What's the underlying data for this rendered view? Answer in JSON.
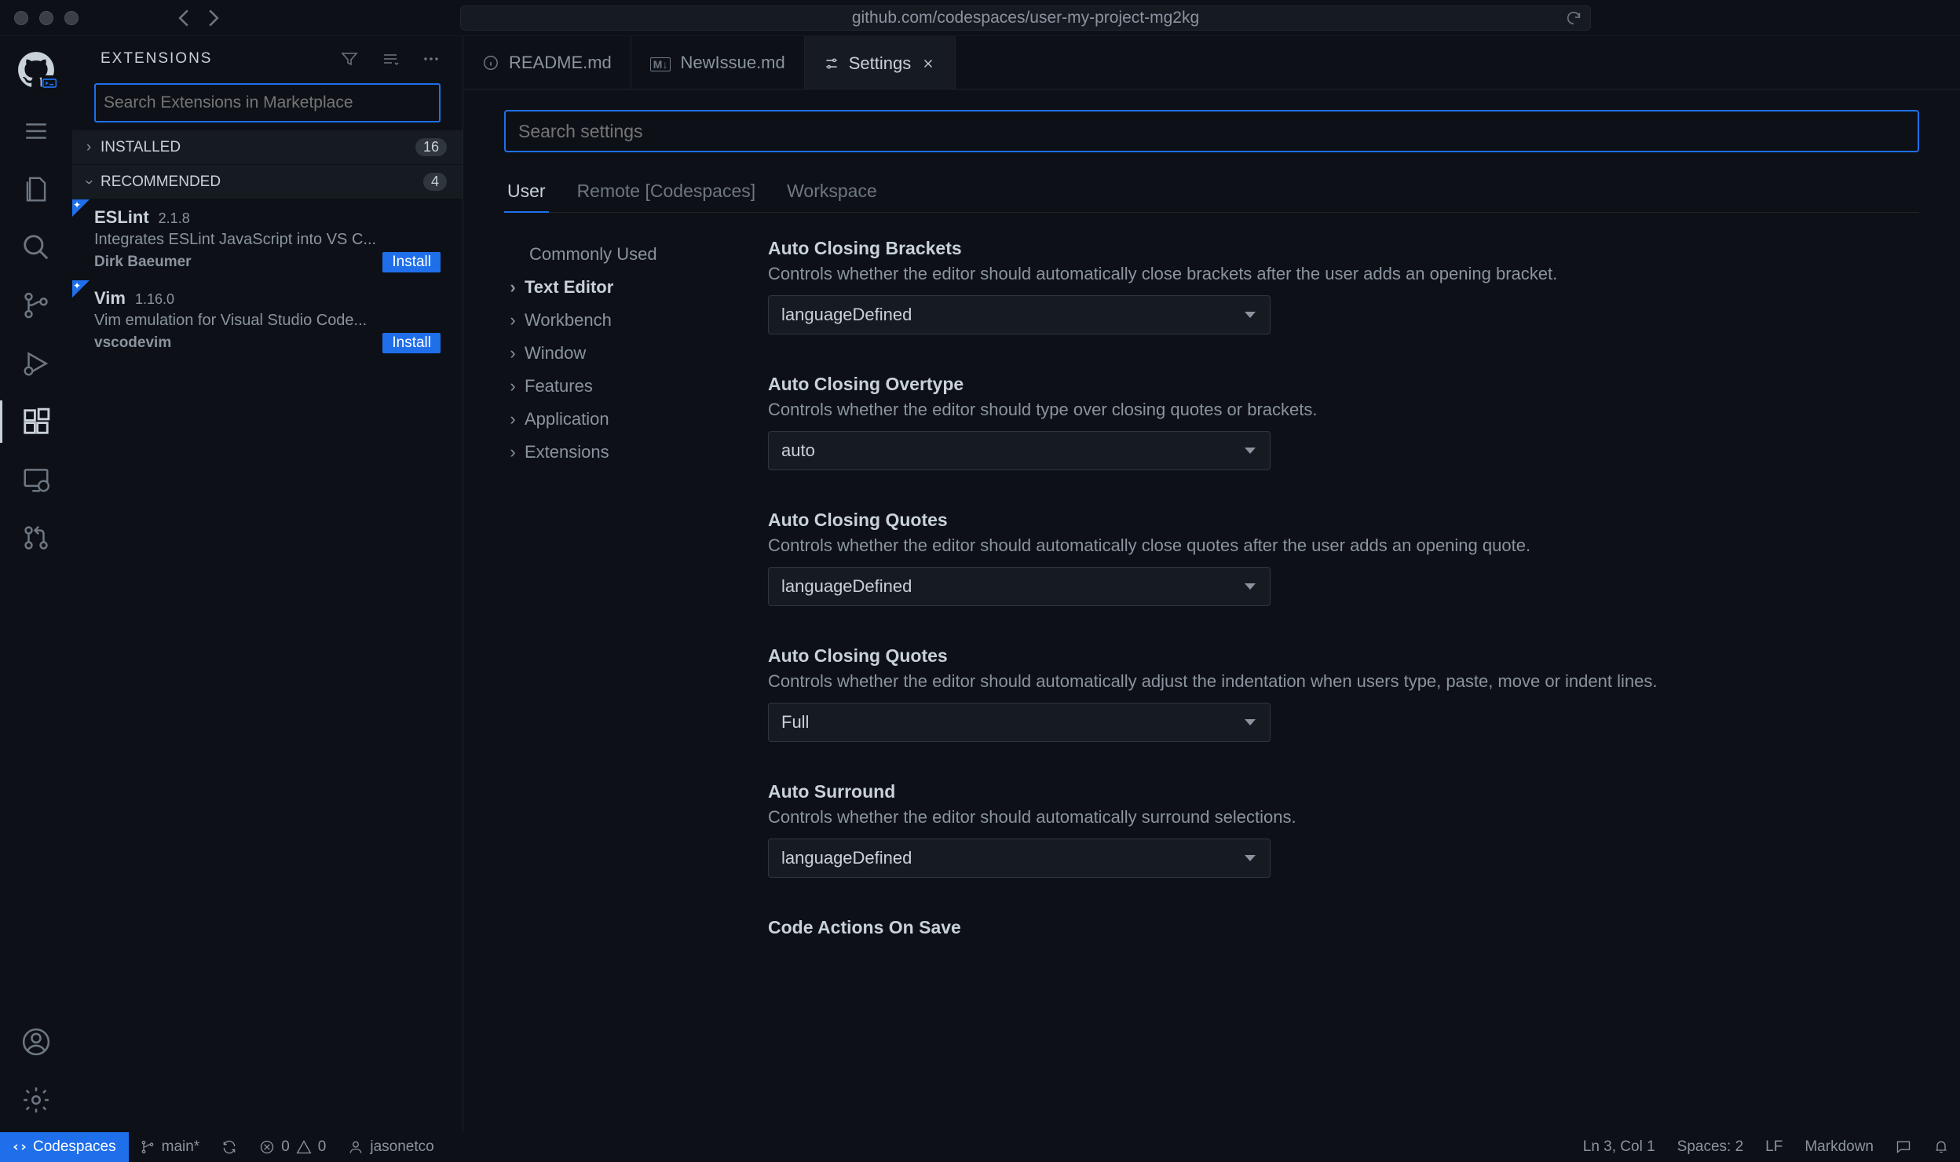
{
  "titlebar": {
    "url": "github.com/codespaces/user-my-project-mg2kg"
  },
  "sidebar": {
    "title": "EXTENSIONS",
    "search_placeholder": "Search Extensions in Marketplace",
    "sections": {
      "installed": {
        "label": "INSTALLED",
        "count": "16"
      },
      "recommended": {
        "label": "RECOMMENDED",
        "count": "4"
      }
    },
    "extensions": [
      {
        "name": "ESLint",
        "version": "2.1.8",
        "description": "Integrates ESLint JavaScript into VS C...",
        "author": "Dirk Baeumer",
        "action": "Install"
      },
      {
        "name": "Vim",
        "version": "1.16.0",
        "description": "Vim emulation for Visual Studio Code...",
        "author": "vscodevim",
        "action": "Install"
      }
    ]
  },
  "tabs": [
    {
      "icon": "info",
      "label": "README.md"
    },
    {
      "icon": "markdown",
      "label": "NewIssue.md"
    },
    {
      "icon": "settings",
      "label": "Settings",
      "active": true,
      "closable": true
    }
  ],
  "settings": {
    "search_placeholder": "Search settings",
    "scopes": [
      "User",
      "Remote [Codespaces]",
      "Workspace"
    ],
    "nav": [
      {
        "label": "Commonly Used",
        "plain": true
      },
      {
        "label": "Text Editor",
        "active": true
      },
      {
        "label": "Workbench"
      },
      {
        "label": "Window"
      },
      {
        "label": "Features"
      },
      {
        "label": "Application"
      },
      {
        "label": "Extensions"
      }
    ],
    "items": [
      {
        "title": "Auto Closing Brackets",
        "desc": "Controls whether the editor should automatically close brackets after the user adds an opening bracket.",
        "value": "languageDefined"
      },
      {
        "title": "Auto Closing Overtype",
        "desc": "Controls whether the editor should type over closing quotes or brackets.",
        "value": "auto"
      },
      {
        "title": "Auto Closing Quotes",
        "desc": "Controls whether the editor should automatically close quotes after the user adds an opening quote.",
        "value": "languageDefined"
      },
      {
        "title": "Auto Closing Quotes",
        "desc": "Controls whether the editor should automatically adjust the indentation when users type, paste, move or indent lines.",
        "value": "Full"
      },
      {
        "title": "Auto Surround",
        "desc": "Controls whether the editor should automatically surround selections.",
        "value": "languageDefined"
      },
      {
        "title": "Code Actions On Save",
        "desc": "",
        "value": ""
      }
    ]
  },
  "statusbar": {
    "codespaces": "Codespaces",
    "branch": "main*",
    "errors": "0",
    "warnings": "0",
    "user": "jasonetco",
    "position": "Ln 3, Col 1",
    "spaces": "Spaces: 2",
    "eol": "LF",
    "language": "Markdown"
  }
}
